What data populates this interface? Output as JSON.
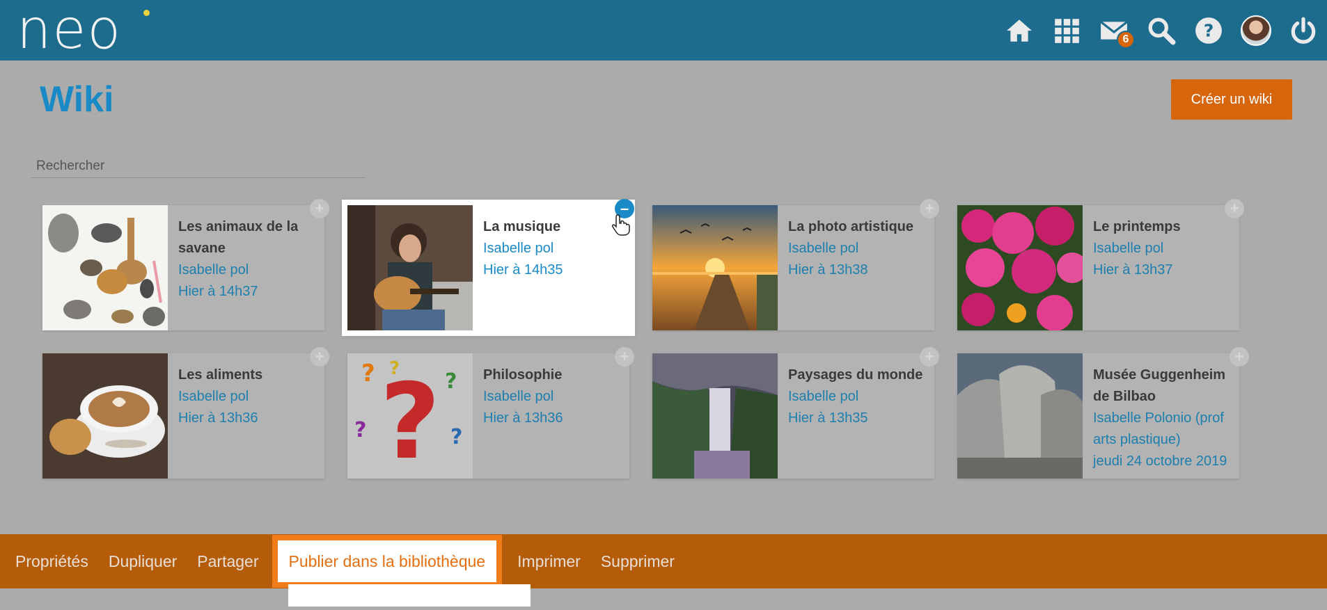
{
  "app": {
    "logo_text": "neo"
  },
  "topbar": {
    "icons": [
      "home-icon",
      "apps-grid-icon",
      "mail-icon",
      "search-icon",
      "help-icon",
      "avatar",
      "power-icon"
    ],
    "mail_badge": "6"
  },
  "page": {
    "title": "Wiki",
    "create_button": "Créer un wiki",
    "search_placeholder": "Rechercher"
  },
  "wikis": [
    {
      "title": "Les animaux de la savane",
      "author": "Isabelle pol",
      "date": "Hier à 14h37",
      "selected": false
    },
    {
      "title": "La musique",
      "author": "Isabelle pol",
      "date": "Hier à 14h35",
      "selected": true
    },
    {
      "title": "La photo artistique",
      "author": "Isabelle pol",
      "date": "Hier à 13h38",
      "selected": false
    },
    {
      "title": "Le printemps",
      "author": "Isabelle pol",
      "date": "Hier à 13h37",
      "selected": false
    },
    {
      "title": "Les aliments",
      "author": "Isabelle pol",
      "date": "Hier à 13h36",
      "selected": false
    },
    {
      "title": "Philosophie",
      "author": "Isabelle pol",
      "date": "Hier à 13h36",
      "selected": false
    },
    {
      "title": "Paysages du monde",
      "author": "Isabelle pol",
      "date": "Hier à 13h35",
      "selected": false
    },
    {
      "title": "Musée Guggenheim de Bilbao",
      "author": "Isabelle Polonio (prof arts plastique)",
      "date": "jeudi 24 octobre 2019",
      "selected": false
    }
  ],
  "toggle": {
    "add": "+",
    "remove": "–"
  },
  "actions": [
    {
      "label": "Propriétés"
    },
    {
      "label": "Dupliquer"
    },
    {
      "label": "Partager"
    },
    {
      "label": "Publier dans la bibliothèque",
      "active": true
    },
    {
      "label": "Imprimer"
    },
    {
      "label": "Supprimer"
    }
  ],
  "colors": {
    "header": "#1d6c8d",
    "accent": "#d7650b",
    "link": "#1a8ac7",
    "overlay": "#ababab",
    "action_bar": "#b45c08"
  }
}
